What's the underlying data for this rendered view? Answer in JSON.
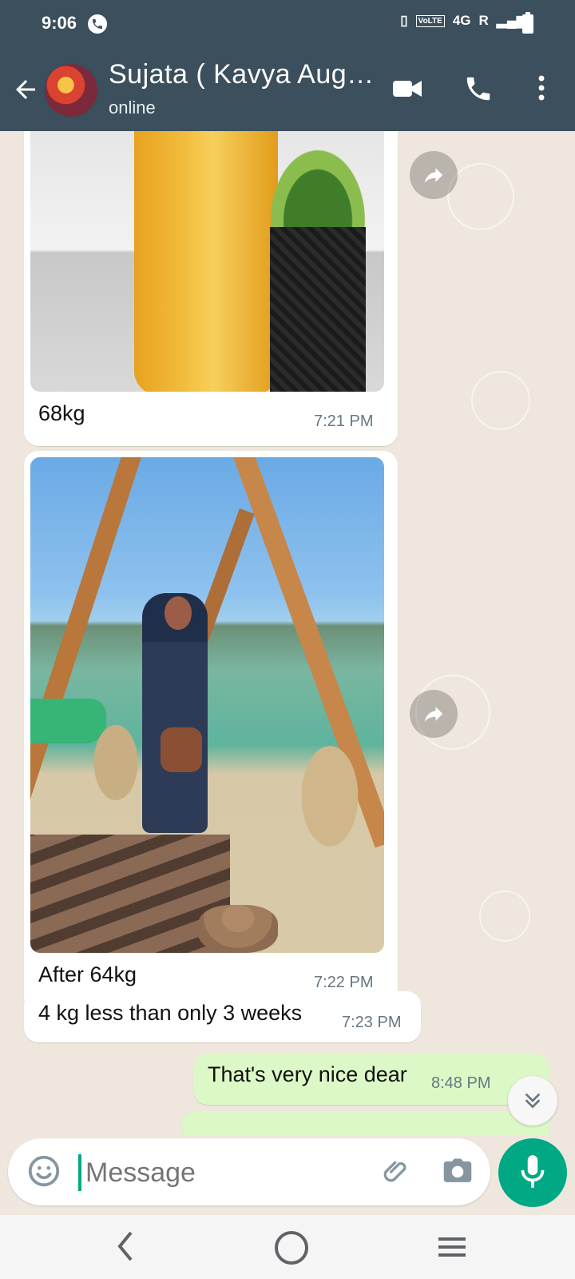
{
  "status_bar": {
    "time": "9:06",
    "network": "4G",
    "carrier_badge": "R",
    "volte": "VoLTE"
  },
  "header": {
    "contact_name": "Sujata ( Kavya Aug…",
    "status": "online"
  },
  "messages": [
    {
      "type": "image",
      "direction": "incoming",
      "caption": "68kg",
      "time": "7:21 PM"
    },
    {
      "type": "image",
      "direction": "incoming",
      "caption": "After 64kg",
      "time": "7:22 PM"
    },
    {
      "type": "text",
      "direction": "incoming",
      "text": "4 kg less than only 3 weeks",
      "time": "7:23 PM"
    },
    {
      "type": "text",
      "direction": "outgoing",
      "text": "That's very nice dear",
      "time": "8:48 PM"
    }
  ],
  "composer": {
    "placeholder": "Message"
  },
  "colors": {
    "header_bg": "#3b4f5c",
    "accent": "#00a884",
    "chat_bg": "#efe7dd",
    "outgoing_bubble": "#dcf8c6"
  },
  "icons": [
    "back-arrow-icon",
    "video-call-icon",
    "voice-call-icon",
    "more-options-icon",
    "forward-icon",
    "scroll-down-icon",
    "emoji-icon",
    "attach-icon",
    "camera-icon",
    "mic-icon"
  ]
}
